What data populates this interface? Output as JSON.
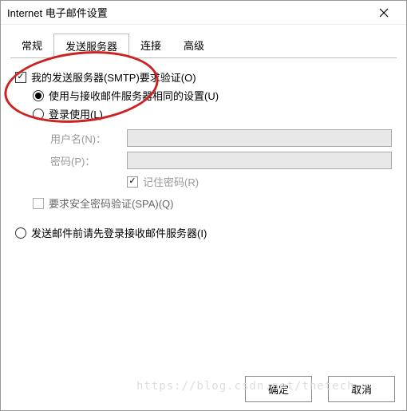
{
  "window": {
    "title": "Internet 电子邮件设置"
  },
  "tabs": {
    "general": "常规",
    "outgoing": "发送服务器",
    "connection": "连接",
    "advanced": "高级"
  },
  "opts": {
    "require_auth": "我的发送服务器(SMTP)要求验证(O)",
    "same_as_incoming": "使用与接收邮件服务器相同的设置(U)",
    "login_using": "登录使用(L)",
    "username_label": "用户名(N)：",
    "password_label": "密码(P)：",
    "remember_password": "记住密码(R)",
    "require_spa": "要求安全密码验证(SPA)(Q)",
    "login_first": "发送邮件前请先登录接收邮件服务器(I)"
  },
  "buttons": {
    "ok": "确定",
    "cancel": "取消"
  },
  "watermark": "https://blog.csdn.net/thetech"
}
